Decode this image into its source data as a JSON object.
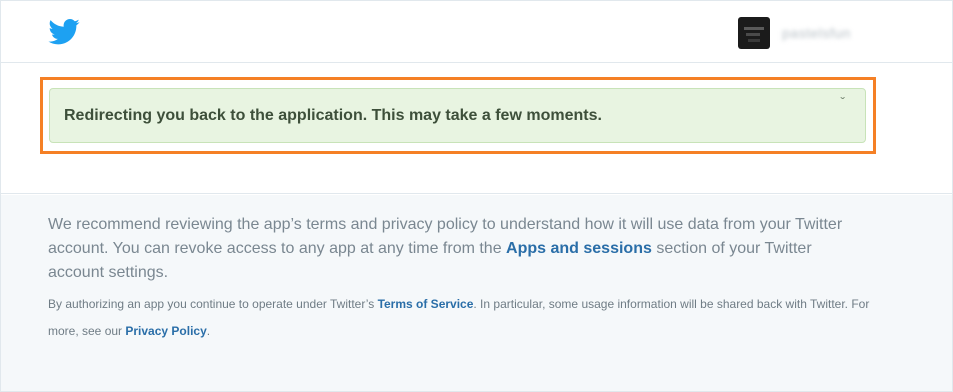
{
  "header": {
    "logo_icon": "twitter-bird-icon",
    "username": "pastelsfun",
    "avatar_icon": "user-avatar"
  },
  "alert": {
    "message": "Redirecting you back to the application. This may take a few moments.",
    "close_icon": "close-icon"
  },
  "footer": {
    "recommend_text_1": "We recommend reviewing the app’s terms and privacy policy to understand how it will use data from your Twitter account. You can revoke access to any app at any time from the ",
    "apps_sessions_link": "Apps and sessions",
    "recommend_text_2": " section of your Twitter account settings.",
    "legal_text_1": "By authorizing an app you continue to operate under Twitter’s ",
    "terms_link": "Terms of Service",
    "legal_text_2": ". In particular, some usage information will be shared back with Twitter. For more, see our ",
    "privacy_link": "Privacy Policy",
    "legal_text_3": "."
  },
  "colors": {
    "twitter_blue": "#1da1f2",
    "link": "#2a6ea8",
    "highlight": "#f58025",
    "alert_bg": "#e8f4e1"
  }
}
